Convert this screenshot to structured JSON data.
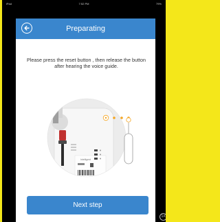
{
  "status_bar": {
    "carrier": "iPad",
    "time": "7:52 PM",
    "battery": "79%"
  },
  "header": {
    "title": "Preparating",
    "back_icon": "back-arrow-circle-icon"
  },
  "content": {
    "instruction": "Please press the reset button , then release the button after hearing the voice  guide.",
    "label_text": "Intelligent"
  },
  "footer": {
    "next_label": "Next step"
  },
  "overlay": {
    "corner_label": "1X"
  },
  "colors": {
    "accent": "#3a86cd",
    "dot": "#f5a623",
    "border": "#f4e71a"
  }
}
